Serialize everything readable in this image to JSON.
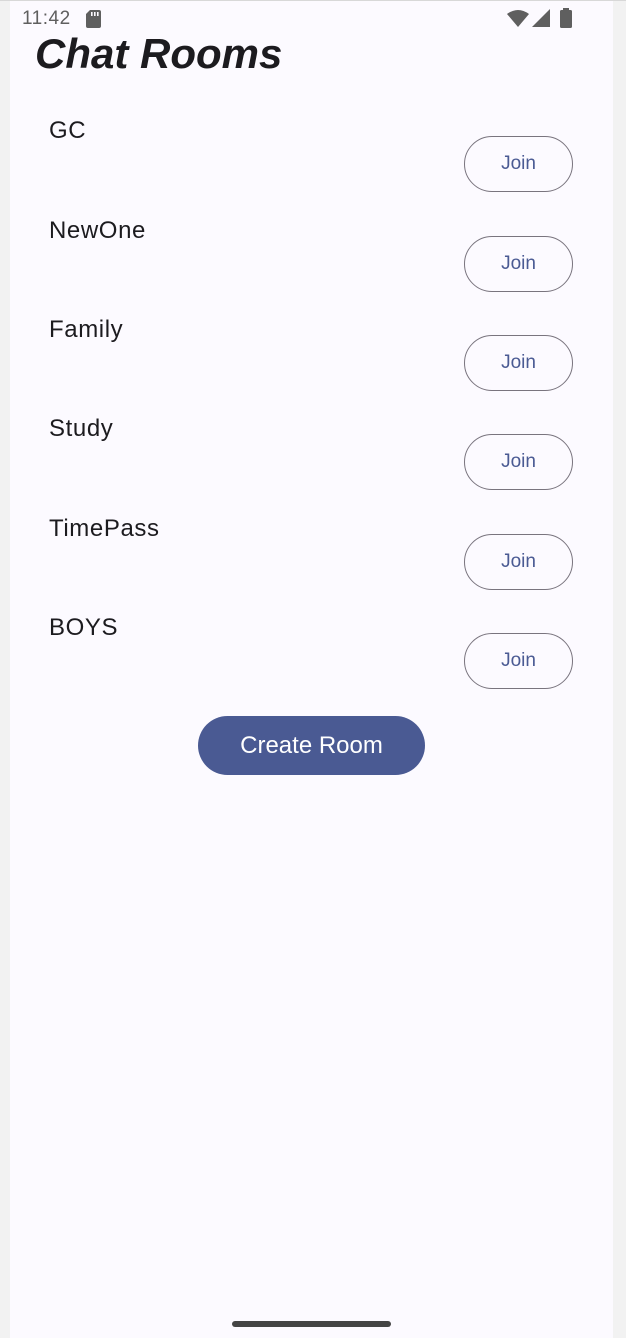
{
  "status_bar": {
    "time": "11:42",
    "icons": [
      "sd-card-icon",
      "wifi-icon",
      "signal-icon",
      "battery-icon"
    ]
  },
  "header": {
    "title": "Chat Rooms"
  },
  "rooms": [
    {
      "name": "GC",
      "join_label": "Join"
    },
    {
      "name": "NewOne",
      "join_label": "Join"
    },
    {
      "name": "Family",
      "join_label": "Join"
    },
    {
      "name": "Study",
      "join_label": "Join"
    },
    {
      "name": "TimePass",
      "join_label": "Join"
    },
    {
      "name": "BOYS",
      "join_label": "Join"
    }
  ],
  "actions": {
    "create_room_label": "Create Room"
  },
  "colors": {
    "background": "#fcfaff",
    "primary": "#4a5a93",
    "outline": "#79747e",
    "text": "#1c1b1f"
  }
}
